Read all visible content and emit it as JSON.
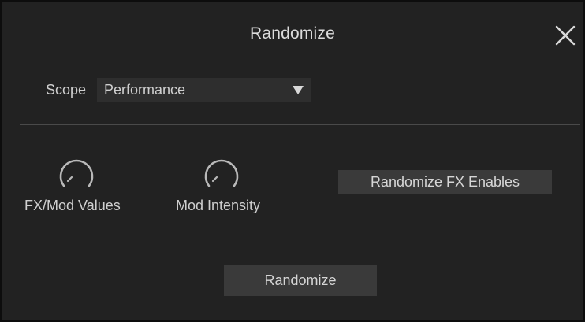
{
  "dialog": {
    "title": "Randomize",
    "close_icon": "close-icon"
  },
  "scope": {
    "label": "Scope",
    "selected": "Performance",
    "dropdown_icon": "triangle-down-icon"
  },
  "knobs": [
    {
      "label": "FX/Mod Values",
      "icon": "knob-icon"
    },
    {
      "label": "Mod Intensity",
      "icon": "knob-icon"
    }
  ],
  "buttons": {
    "randomize_fx_enables": "Randomize FX Enables",
    "randomize": "Randomize"
  },
  "colors": {
    "background": "#222222",
    "border": "#0d0d0d",
    "button": "#3a3a3a",
    "text": "#d6d6d6"
  }
}
